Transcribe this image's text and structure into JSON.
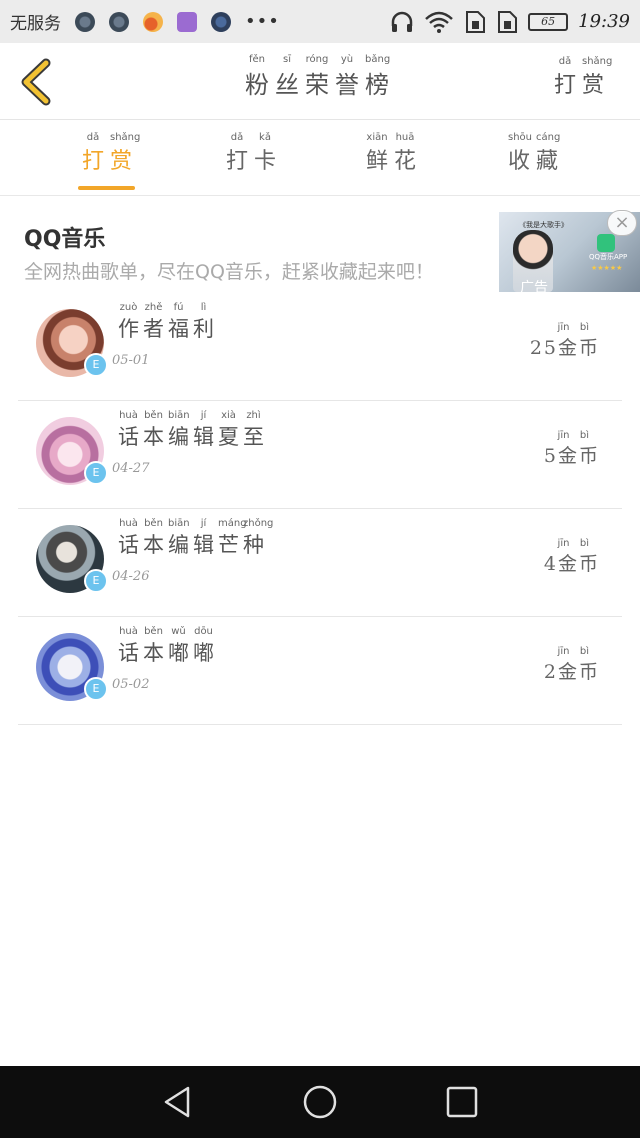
{
  "status_bar": {
    "carrier": "无服务",
    "battery": "65",
    "time": "19:39",
    "icons": [
      "wechat-icon",
      "wechat-icon",
      "weibo-icon",
      "gallery-icon",
      "baidu-icon",
      "more-icon",
      "headphone-icon",
      "wifi-icon",
      "sim1-icon",
      "sim2-icon",
      "battery-icon"
    ]
  },
  "header": {
    "title": "粉丝荣誉榜",
    "title_pinyin": [
      "fěn",
      "sī",
      "róng",
      "yù",
      "bǎng"
    ],
    "action": "打赏",
    "action_pinyin": [
      "dǎ",
      "shǎng"
    ]
  },
  "tabs": [
    {
      "label": "打赏",
      "pinyin": [
        "dǎ",
        "shǎng"
      ],
      "active": true
    },
    {
      "label": "打卡",
      "pinyin": [
        "dǎ",
        "kǎ"
      ],
      "active": false
    },
    {
      "label": "鲜花",
      "pinyin": [
        "xiān",
        "huā"
      ],
      "active": false
    },
    {
      "label": "收藏",
      "pinyin": [
        "shōu",
        "cáng"
      ],
      "active": false
    }
  ],
  "ad": {
    "title": "QQ音乐",
    "description": "全网热曲歌单，尽在QQ音乐，赶紧收藏起来吧！",
    "image_song": "《我是大歌手》",
    "image_app": "QQ音乐APP",
    "image_stars": "★★★★★",
    "label": "广告",
    "close": "×"
  },
  "rows": [
    {
      "name": "作者福利",
      "name_pinyin": [
        "zuò",
        "zhě",
        "fú",
        "lì"
      ],
      "date": "05-01",
      "coins": "25金币",
      "coins_pinyin": [
        "jīn",
        "bì"
      ],
      "badge": "E"
    },
    {
      "name": "话本编辑夏至",
      "name_pinyin": [
        "huà",
        "běn",
        "biān",
        "jí",
        "xià",
        "zhì"
      ],
      "date": "04-27",
      "coins": "5金币",
      "coins_pinyin": [
        "jīn",
        "bì"
      ],
      "badge": "E"
    },
    {
      "name": "话本编辑芒种",
      "name_pinyin": [
        "huà",
        "běn",
        "biān",
        "jí",
        "máng",
        "zhǒng"
      ],
      "date": "04-26",
      "coins": "4金币",
      "coins_pinyin": [
        "jīn",
        "bì"
      ],
      "badge": "E"
    },
    {
      "name": "话本嘟嘟",
      "name_pinyin": [
        "huà",
        "běn",
        "wǔ",
        "dōu"
      ],
      "date": "05-02",
      "coins": "2金币",
      "coins_pinyin": [
        "jīn",
        "bì"
      ],
      "badge": "E"
    }
  ],
  "colors": {
    "accent": "#f2a629",
    "back_arrow_stroke": "#f2c233",
    "nav_bg": "#0d0d0d",
    "status_bg": "#ececec"
  },
  "nav_bar": {
    "buttons": [
      "back-triangle-icon",
      "home-circle-icon",
      "recents-square-icon"
    ]
  }
}
